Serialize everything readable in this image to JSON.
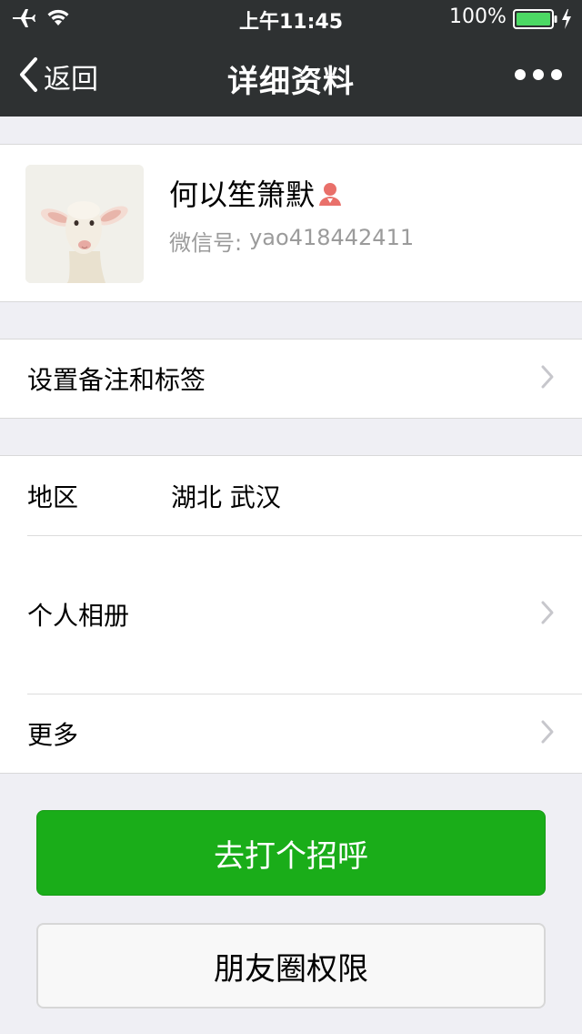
{
  "status_bar": {
    "time": "上午11:45",
    "battery_percent": "100%",
    "icons": [
      "airplane-icon",
      "wifi-icon",
      "battery-icon",
      "charging-bolt-icon"
    ]
  },
  "nav": {
    "back_label": "返回",
    "title": "详细资料",
    "more_icon": "more-dots-icon"
  },
  "profile": {
    "nickname": "何以笙箫默",
    "gender_icon": "female-icon",
    "wechat_id_label": "微信号:",
    "wechat_id": "yao418442411"
  },
  "remark": {
    "label": "设置备注和标签"
  },
  "details": {
    "region_label": "地区",
    "region_value": "湖北 武汉",
    "album_label": "个人相册",
    "more_label": "更多"
  },
  "buttons": {
    "greet": "去打个招呼",
    "moments_permission": "朋友圈权限"
  },
  "colors": {
    "nav_bg": "#2e3132",
    "page_bg": "#efeff4",
    "accent_green": "#1aad19",
    "gender_icon": "#e9706a"
  }
}
